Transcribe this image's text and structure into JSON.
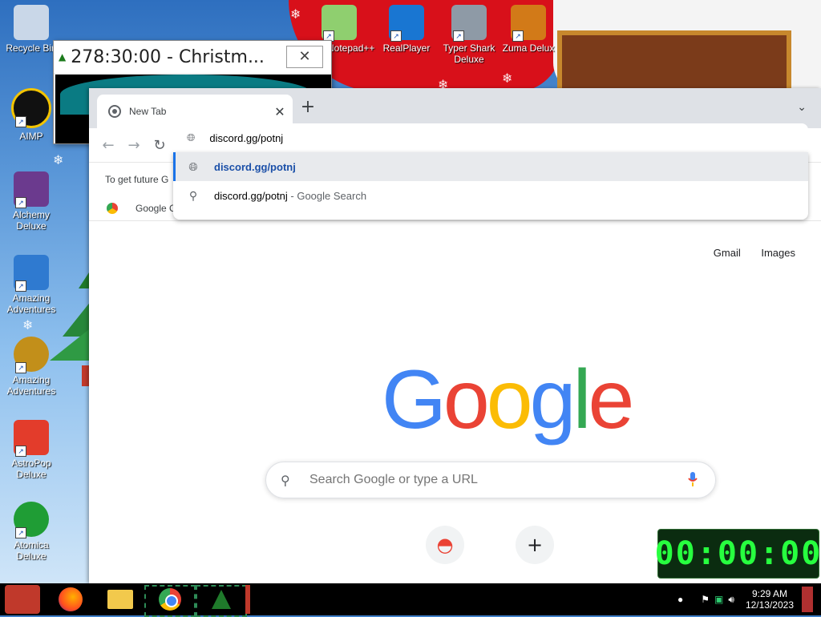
{
  "desktop": {
    "icons": [
      {
        "label": "Recycle Bin",
        "color": "#b0c4de"
      },
      {
        "label": "AIMP",
        "color": "#1a1a1a"
      },
      {
        "label": "Alchemy Deluxe",
        "color": "#6b3a8e"
      },
      {
        "label": "Amazing Adventures",
        "color": "#2f7ad0"
      },
      {
        "label": "Amazing Adventures",
        "color": "#c28f1a"
      },
      {
        "label": "AstroPop Deluxe",
        "color": "#e33c2b"
      },
      {
        "label": "Atomica Deluxe",
        "color": "#1f9d35"
      },
      {
        "label": "Notepad++",
        "color": "#8fcf6f"
      },
      {
        "label": "RealPlayer",
        "color": "#1976d2"
      },
      {
        "label": "Typer Shark Deluxe",
        "color": "#8e9aa6"
      },
      {
        "label": "Zuma Delux",
        "color": "#d27a18"
      }
    ]
  },
  "timer_window": {
    "title": "278:30:00 - Christm...",
    "close_glyph": "✕"
  },
  "chrome": {
    "tab": {
      "title": "New Tab",
      "close_glyph": "✕"
    },
    "new_tab_glyph": "+",
    "tab_menu_glyph": "⌄",
    "nav": {
      "back": "←",
      "forward": "→",
      "reload": "↻"
    },
    "address_text": "discord.gg/potnj",
    "infobar_text": "To get future G",
    "bookmark_text": "Google C",
    "omnibox": {
      "rows": [
        {
          "icon": "globe",
          "text": "discord.gg/potnj",
          "suffix": ""
        },
        {
          "icon": "globe",
          "text": "discord.gg/potnj",
          "suffix": ""
        },
        {
          "icon": "search",
          "text": "discord.gg/potnj",
          "suffix": " - Google Search"
        }
      ]
    },
    "top_links": {
      "gmail": "Gmail",
      "images": "Images"
    },
    "logo": {
      "letters": [
        "G",
        "o",
        "o",
        "g",
        "l",
        "e"
      ],
      "colors": [
        "#4285f4",
        "#ea4335",
        "#fbbc05",
        "#4285f4",
        "#34a853",
        "#ea4335"
      ]
    },
    "search_placeholder": "Search Google or type a URL",
    "shortcuts": [
      {
        "glyph": "◓"
      },
      {
        "glyph": "+"
      }
    ]
  },
  "digital_clock": "00:00:00",
  "taskbar": {
    "time": "9:29 AM",
    "date": "12/13/2023"
  }
}
